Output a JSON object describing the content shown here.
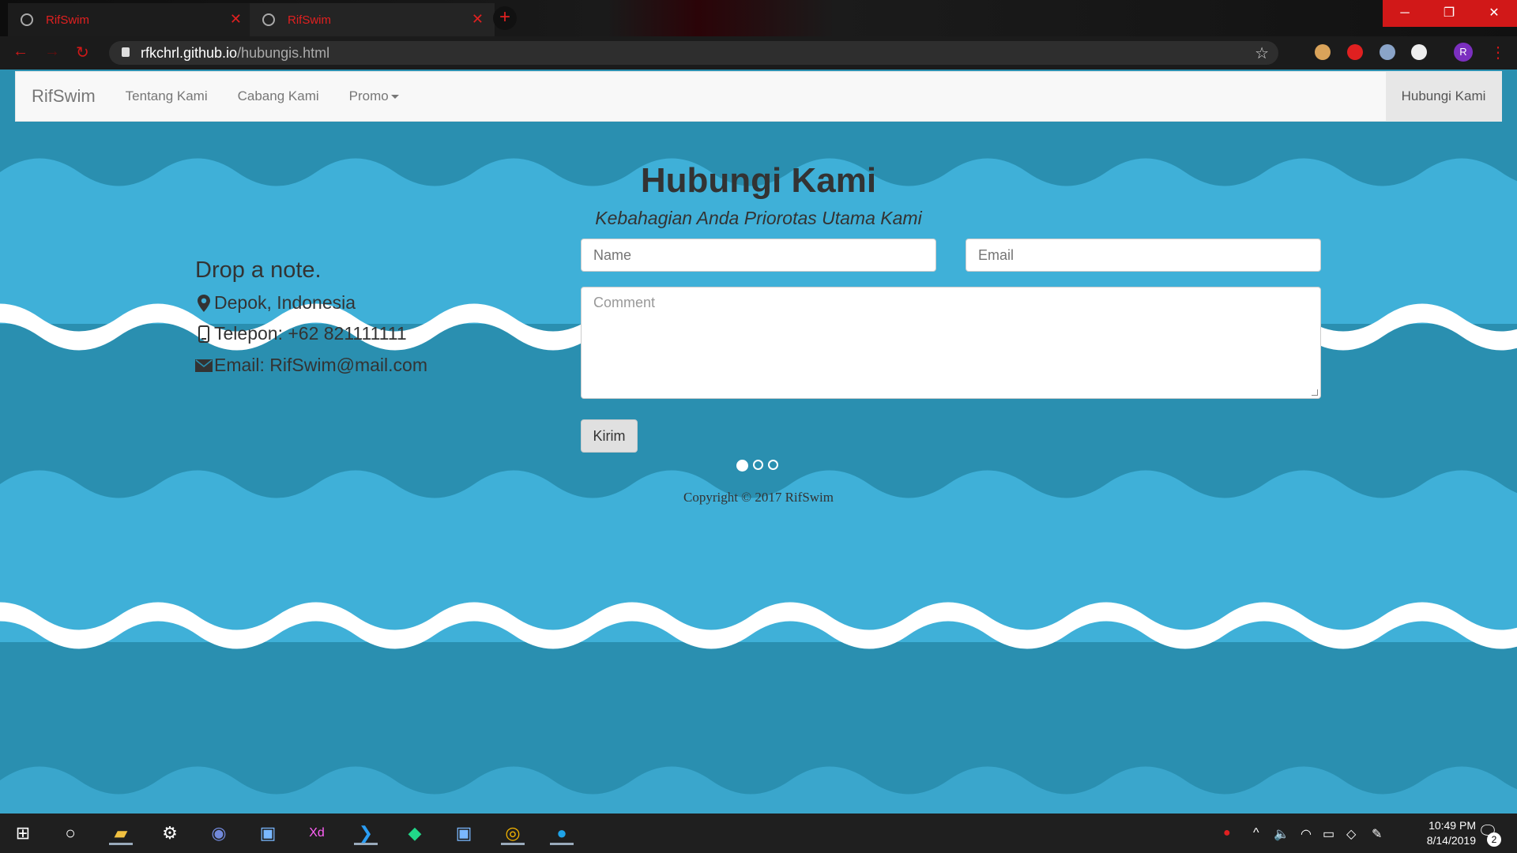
{
  "browser": {
    "tabs": [
      {
        "title": "RifSwim",
        "close": "✕"
      },
      {
        "title": "RifSwim",
        "close": "✕"
      }
    ],
    "new_tab": "+",
    "url_host": "rfkchrl.github.io",
    "url_path": "/hubungis.html",
    "profile_initial": "R",
    "controls": {
      "minimize": "─",
      "maximize": "❐",
      "close": "✕"
    }
  },
  "navbar": {
    "brand": "RifSwim",
    "links": [
      "Tentang Kami",
      "Cabang Kami",
      "Promo"
    ],
    "right": "Hubungi Kami"
  },
  "page": {
    "title": "Hubungi Kami",
    "subtitle": "Kebahagian Anda Priorotas Utama Kami",
    "note_heading": "Drop a note.",
    "location": "Depok, Indonesia",
    "phone": "Telepon: +62 821111111",
    "email": "Email: RifSwim@mail.com"
  },
  "form": {
    "name_placeholder": "Name",
    "email_placeholder": "Email",
    "comment_placeholder": "Comment",
    "submit": "Kirim"
  },
  "carousel": {
    "count": 3,
    "active": 1
  },
  "footer": {
    "copyright": "Copyright © 2017 RifSwim"
  },
  "taskbar": {
    "time": "10:49 PM",
    "date": "8/14/2019",
    "notifications": "2"
  },
  "colors": {
    "browser_accent": "#e02020",
    "page_bg": "#2a8fb0",
    "wave_light": "#3fb0d8",
    "wave_white": "#ffffff"
  }
}
